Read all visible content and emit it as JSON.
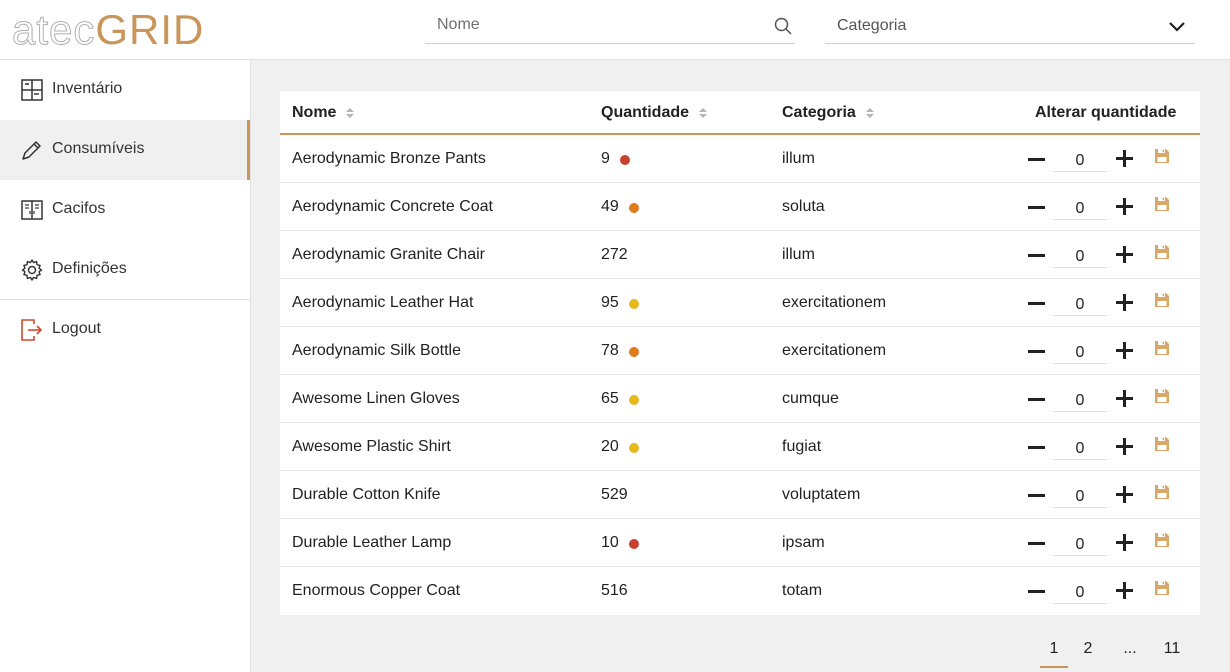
{
  "brand": {
    "logo_light": "atec",
    "logo_bold": "GRID"
  },
  "header": {
    "search_placeholder": "Nome",
    "category_label": "Categoria"
  },
  "sidebar": {
    "items": [
      {
        "label": "Inventário",
        "icon": "grid-table-icon"
      },
      {
        "label": "Consumíveis",
        "icon": "pencil-icon"
      },
      {
        "label": "Cacifos",
        "icon": "lockers-icon"
      },
      {
        "label": "Definições",
        "icon": "gear-icon"
      },
      {
        "label": "Logout",
        "icon": "logout-icon"
      }
    ],
    "active": 1
  },
  "table": {
    "columns": {
      "name": "Nome",
      "quantity": "Quantidade",
      "category": "Categoria",
      "change": "Alterar quantidade"
    },
    "rows": [
      {
        "name": "Aerodynamic Bronze Pants",
        "quantity": "9",
        "status": "red",
        "category": "illum",
        "delta": "0"
      },
      {
        "name": "Aerodynamic Concrete Coat",
        "quantity": "49",
        "status": "orange",
        "category": "soluta",
        "delta": "0"
      },
      {
        "name": "Aerodynamic Granite Chair",
        "quantity": "272",
        "status": "none",
        "category": "illum",
        "delta": "0"
      },
      {
        "name": "Aerodynamic Leather Hat",
        "quantity": "95",
        "status": "yellow",
        "category": "exercitationem",
        "delta": "0"
      },
      {
        "name": "Aerodynamic Silk Bottle",
        "quantity": "78",
        "status": "orange",
        "category": "exercitationem",
        "delta": "0"
      },
      {
        "name": "Awesome Linen Gloves",
        "quantity": "65",
        "status": "yellow",
        "category": "cumque",
        "delta": "0"
      },
      {
        "name": "Awesome Plastic Shirt",
        "quantity": "20",
        "status": "yellow",
        "category": "fugiat",
        "delta": "0"
      },
      {
        "name": "Durable Cotton Knife",
        "quantity": "529",
        "status": "none",
        "category": "voluptatem",
        "delta": "0"
      },
      {
        "name": "Durable Leather Lamp",
        "quantity": "10",
        "status": "red",
        "category": "ipsam",
        "delta": "0"
      },
      {
        "name": "Enormous Copper Coat",
        "quantity": "516",
        "status": "none",
        "category": "totam",
        "delta": "0"
      }
    ]
  },
  "pagination": {
    "pages": [
      "1",
      "2",
      "...",
      "11"
    ],
    "current": "1"
  },
  "colors": {
    "accent": "#c8965a",
    "status_red": "#c8402e",
    "status_orange": "#e27a1c",
    "status_yellow": "#e3b91c"
  }
}
